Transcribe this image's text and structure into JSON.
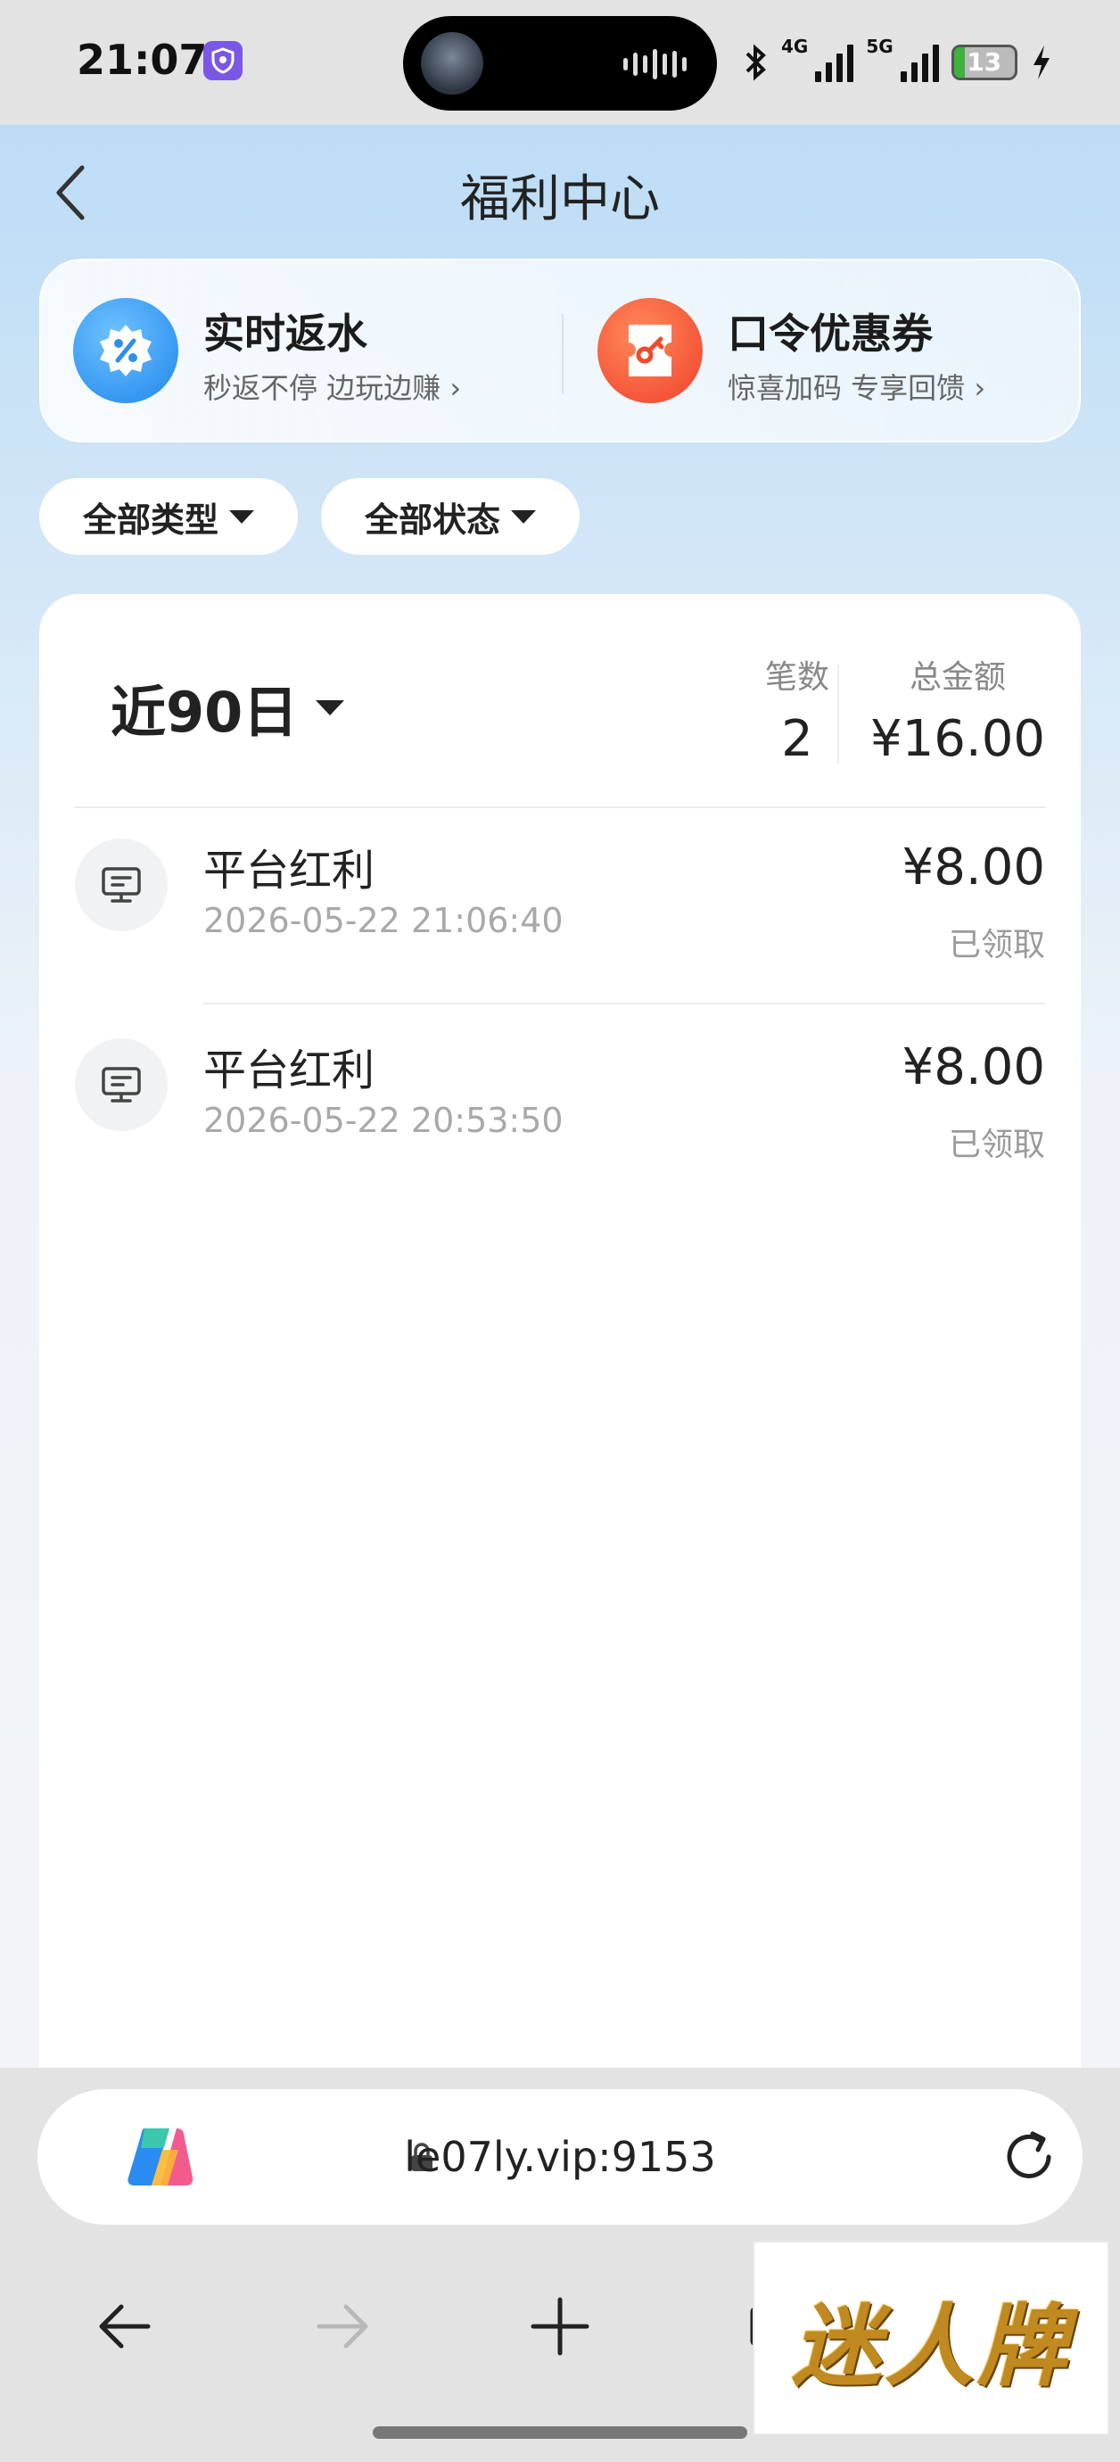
{
  "status_bar": {
    "time": "21:07",
    "network_1": "4G",
    "network_2": "5G",
    "battery": "13"
  },
  "header": {
    "title": "福利中心"
  },
  "promos": [
    {
      "title": "实时返水",
      "subtitle": "秒返不停 边玩边赚 ›"
    },
    {
      "title": "口令优惠券",
      "subtitle": "惊喜加码 专享回馈 ›"
    }
  ],
  "filters": {
    "type": "全部类型",
    "status": "全部状态"
  },
  "summary": {
    "period": "近90日",
    "count_label": "笔数",
    "count": "2",
    "total_label": "总金额",
    "total": "¥16.00"
  },
  "records": [
    {
      "title": "平台红利",
      "datetime": "2026-05-22 21:06:40",
      "amount": "¥8.00",
      "status": "已领取"
    },
    {
      "title": "平台红利",
      "datetime": "2026-05-22 20:53:50",
      "amount": "¥8.00",
      "status": "已领取"
    }
  ],
  "browser": {
    "url": "le07ly.vip:9153"
  },
  "watermark": {
    "text": "迷人牌"
  },
  "colors": {
    "accent_blue": "#2f8ff0",
    "accent_red": "#f04a2a",
    "page_gradient_top": "#bcdcf6"
  }
}
